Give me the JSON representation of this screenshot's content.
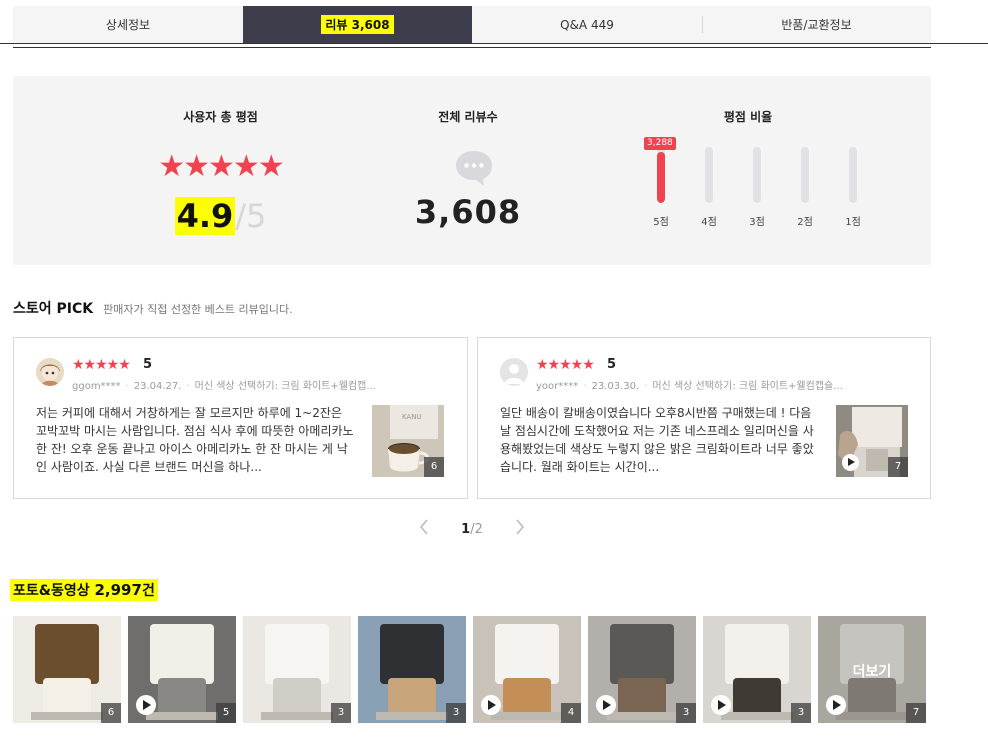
{
  "tabs": [
    {
      "label": "상세정보",
      "active": false
    },
    {
      "label": "리뷰 3,608",
      "active": true
    },
    {
      "label": "Q&A 449",
      "active": false
    },
    {
      "label": "반품/교환정보",
      "active": false
    }
  ],
  "summary": {
    "rating_title": "사용자 총 평점",
    "stars": "★★★★★",
    "score": "4.9",
    "score_max": "/5",
    "count_title": "전체 리뷰수",
    "count": "3,608",
    "ratio_title": "평점 비율",
    "ratio": [
      {
        "label": "5점",
        "count_badge": "3,288",
        "fraction": 0.91
      },
      {
        "label": "4점",
        "fraction": 0
      },
      {
        "label": "3점",
        "fraction": 0
      },
      {
        "label": "2점",
        "fraction": 0
      },
      {
        "label": "1점",
        "fraction": 0
      }
    ],
    "accent_color": "#f1434f"
  },
  "store_pick": {
    "title": "스토어 PICK",
    "subtitle": "판매자가 직접 선정한 베스트 리뷰입니다.",
    "cards": [
      {
        "stars": "★★★★★",
        "score": "5",
        "user": "ggom****",
        "date": "23.04.27.",
        "option": "머신 색상 선택하기: 크림 화이트+웰컴캡...",
        "text": "저는 커피에 대해서 거창하게는 잘 모르지만 하루에 1~2잔은 꼬박꼬박 마시는 사람입니다. 점심 식사 후에 따뜻한 아메리카노 한 잔! 오후 운동 끝나고 아이스 아메리카노 한 잔 마시는 게 낙인 사람이죠. 사실 다른 브랜드 머신을 하나...",
        "thumb_count": "6",
        "video": false
      },
      {
        "stars": "★★★★★",
        "score": "5",
        "user": "yoor****",
        "date": "23.03.30.",
        "option": "머신 색상 선택하기: 크림 화이트+웰컴캡슐...",
        "text": "일단 배송이 칼배송이였습니다 오후8시반쯤 구매했는데 ! 다음날 점심시간에 도착했어요 저는 기존 네스프레소 일리머신을 사용해봤었는데 색상도 누렇지 않은 밝은 크림화이트라 너무 좋았습니다. 월래 화이트는 시간이...",
        "thumb_count": "7",
        "video": true
      }
    ]
  },
  "pager": {
    "current": "1",
    "sep": "/",
    "total": "2"
  },
  "photos": {
    "title": "포토&동영상",
    "count": "2,997",
    "unit": "건",
    "more_label": "더보기",
    "tiles": [
      {
        "count": "6",
        "video": false
      },
      {
        "count": "5",
        "video": true
      },
      {
        "count": "3",
        "video": false
      },
      {
        "count": "3",
        "video": false
      },
      {
        "count": "4",
        "video": true
      },
      {
        "count": "3",
        "video": true
      },
      {
        "count": "3",
        "video": true
      },
      {
        "count": "7",
        "video": true
      }
    ]
  }
}
